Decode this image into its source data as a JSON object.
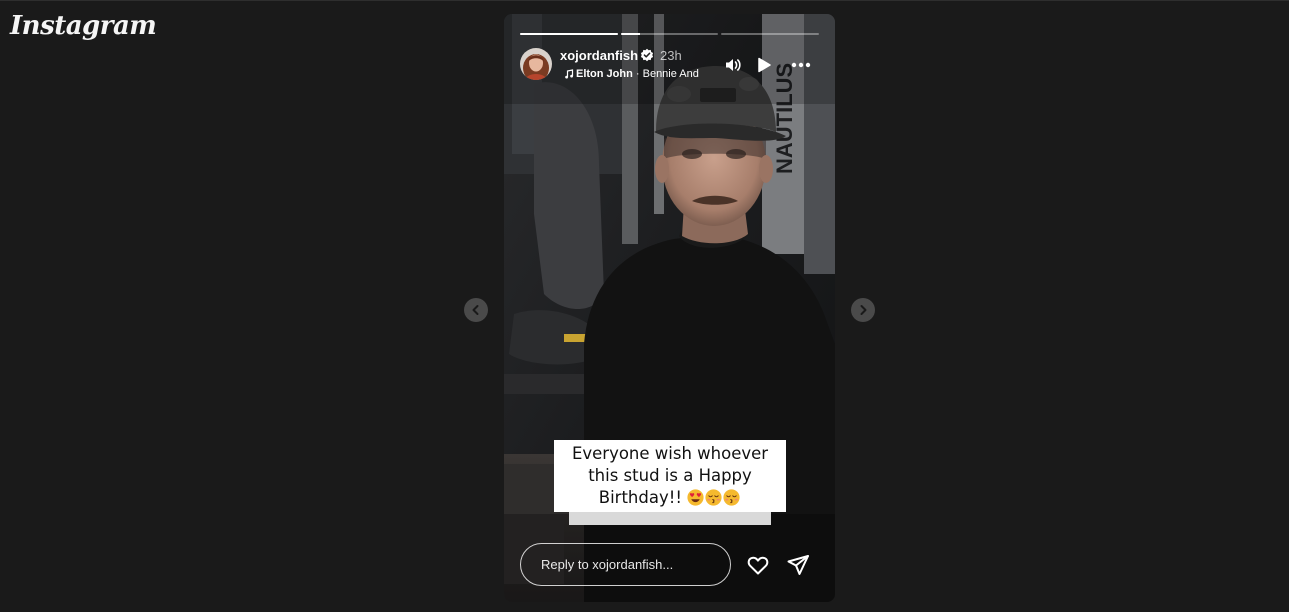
{
  "app": {
    "logo_text": "Instagram"
  },
  "story": {
    "username": "xojordanfish",
    "verified": true,
    "time_ago": "23h",
    "music": {
      "artist": "Elton John",
      "separator": " · ",
      "title": "Bennie And"
    },
    "progress": {
      "segments": [
        {
          "progress": 1.0
        },
        {
          "progress": 0.2
        },
        {
          "progress": 0.0
        }
      ]
    },
    "caption": {
      "text": "Everyone wish whoever this stud is a Happy Birthday!!",
      "emojis": [
        "heart-eyes-emoji",
        "kissing-closed-eyes-emoji",
        "kissing-closed-eyes-emoji"
      ]
    },
    "reply_placeholder": "Reply to xojordanfish..."
  },
  "icons": {
    "volume": "volume-icon",
    "play": "play-icon",
    "more": "more-options-icon",
    "previous": "chevron-left-icon",
    "next": "chevron-right-icon",
    "like": "heart-icon",
    "share": "send-icon",
    "verified": "verified-badge-icon",
    "music": "music-note-icon"
  },
  "colors": {
    "background": "#1a1a1a",
    "nav_button": "#4a4a4a",
    "caption_background": "#ffffff",
    "verified_badge": "#ffffff"
  }
}
